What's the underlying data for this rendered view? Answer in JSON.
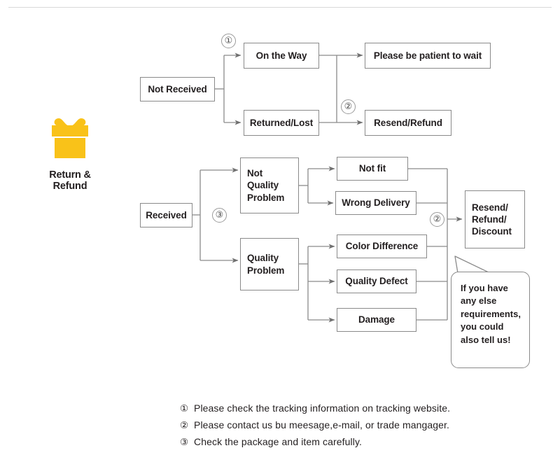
{
  "page": {
    "title": "Return & Refund",
    "divider_color": "#d8d8d8",
    "line_color": "#8a8a8a",
    "text_color": "#231f20",
    "accent_color": "#f9c219"
  },
  "brand": {
    "icon": "gift-box-icon",
    "label": "Return & Refund",
    "icon_color": "#f9c219"
  },
  "flow": {
    "not_received": {
      "label": "Not Received",
      "step_marker": "①",
      "branches": [
        {
          "label": "On the Way",
          "result": "Please be patient to wait"
        },
        {
          "label": "Returned/Lost",
          "result": "Resend/Refund"
        }
      ],
      "result_marker": "②"
    },
    "received": {
      "label": "Received",
      "step_marker": "③",
      "groups": [
        {
          "label": "Not\nQuality\nProblem",
          "label_lines": [
            "Not",
            "Quality",
            "Problem"
          ],
          "reasons": [
            "Not fit",
            "Wrong Delivery"
          ]
        },
        {
          "label": "Quality\nProblem",
          "label_lines": [
            "Quality",
            "Problem"
          ],
          "reasons": [
            "Color Difference",
            "Quality Defect",
            "Damage"
          ]
        }
      ],
      "result_marker": "②",
      "result_lines": [
        "Resend/",
        "Refund/",
        "Discount"
      ]
    }
  },
  "callout": {
    "lines": [
      "If you have",
      "any else",
      "requirements,",
      "you could",
      "also tell us!"
    ]
  },
  "notes": [
    {
      "marker": "①",
      "text": "Please check the tracking information on tracking website."
    },
    {
      "marker": "②",
      "text": "Please contact us bu meesage,e-mail, or trade mangager."
    },
    {
      "marker": "③",
      "text": "Check the package and item carefully."
    }
  ]
}
